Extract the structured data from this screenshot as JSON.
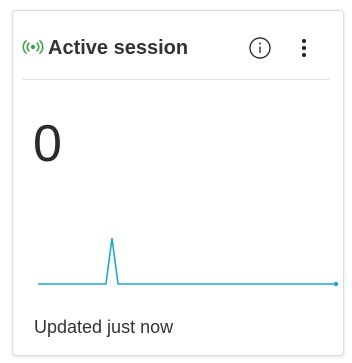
{
  "card": {
    "title": "Active session",
    "value": "0",
    "status": "Updated just now"
  },
  "icons": {
    "live": "live-broadcast-icon",
    "info": "info-icon",
    "more": "more-vertical-icon"
  },
  "colors": {
    "live_icon": "#3aa548",
    "sparkline": "#1fa8cc",
    "text": "#333333"
  },
  "chart_data": {
    "type": "line",
    "series": [
      {
        "values": [
          0,
          0,
          1,
          0,
          0,
          0,
          0,
          0,
          0,
          0
        ]
      }
    ],
    "title": "",
    "xlabel": "",
    "ylabel": ""
  }
}
